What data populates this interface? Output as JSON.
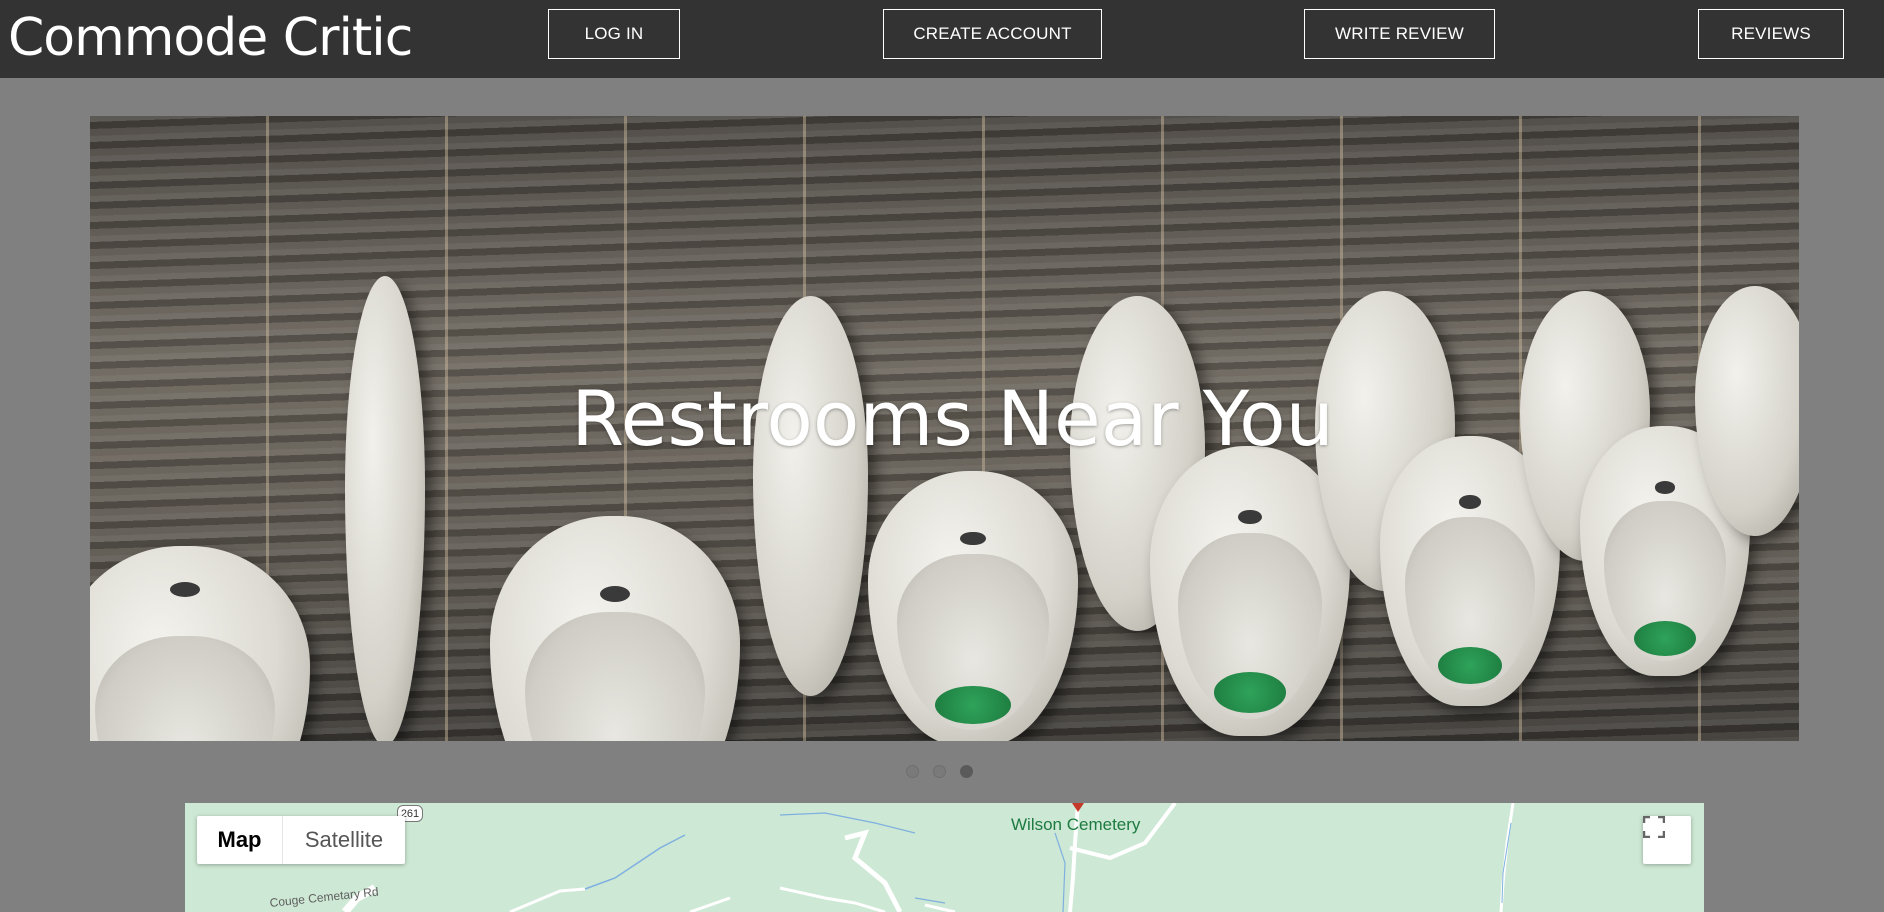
{
  "header": {
    "brand": "Commode Critic",
    "nav": {
      "login": "LOG IN",
      "create_account": "CREATE ACCOUNT",
      "write_review": "WRITE REVIEW",
      "reviews": "REVIEWS"
    }
  },
  "hero": {
    "title": "Restrooms Near You",
    "slide_count": 3,
    "active_slide": 3
  },
  "map": {
    "type_controls": {
      "map": "Map",
      "satellite": "Satellite"
    },
    "selected_type": "Map",
    "labels": {
      "cemetery": "Wilson Cemetery",
      "road": "Couge Cemetary Rd",
      "route_number": "261"
    }
  },
  "colors": {
    "navbar_bg": "#333333",
    "page_bg": "#808080",
    "map_bg": "#cde8d4",
    "map_label_green": "#1d7a40"
  }
}
